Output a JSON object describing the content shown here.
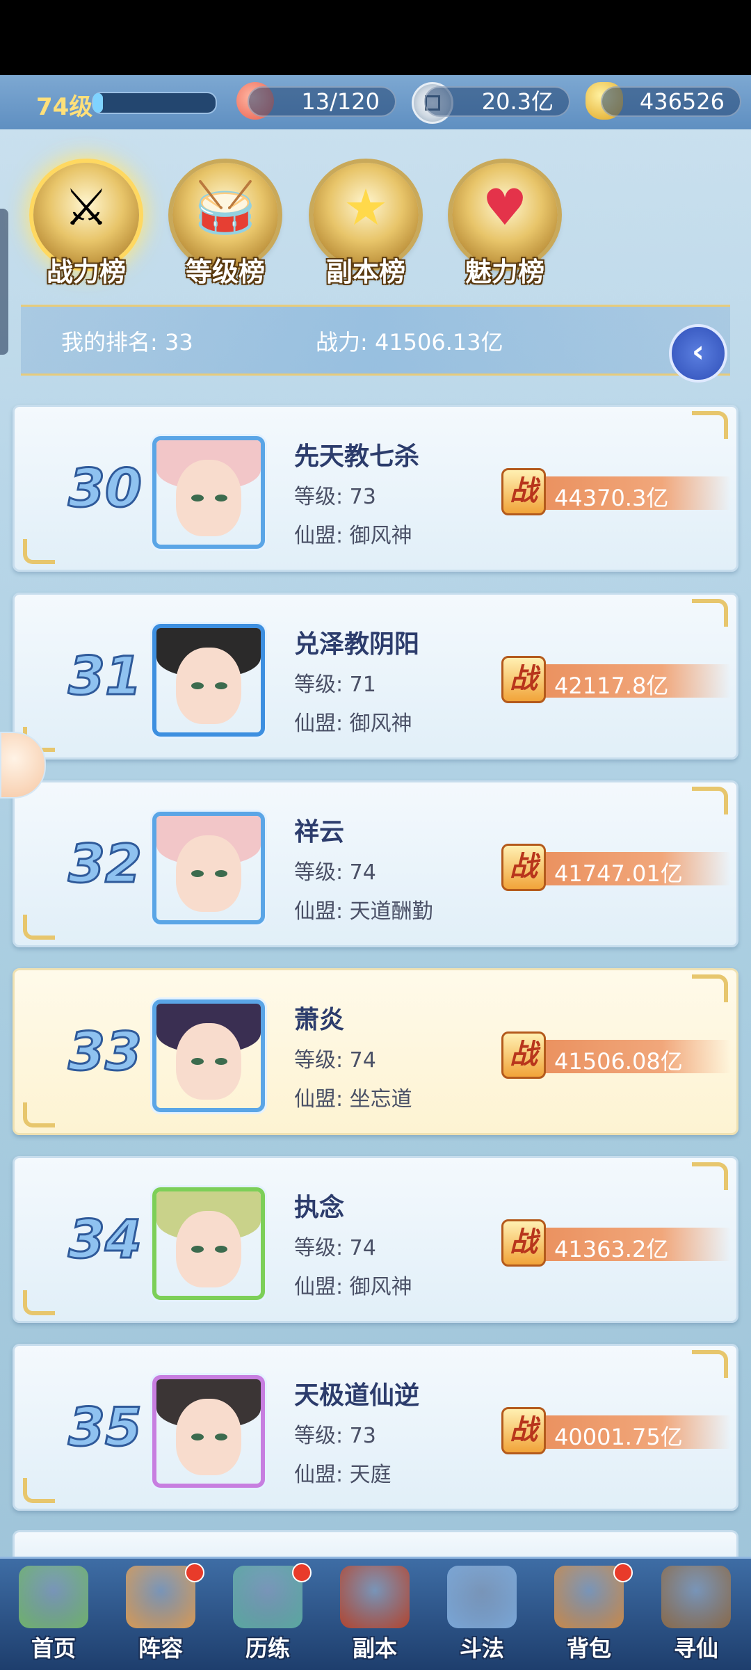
{
  "resources": {
    "level": "74级",
    "xp_progress": 0.08,
    "stamina": "13/120",
    "silver": "20.3亿",
    "gold": "436526"
  },
  "tabs": [
    {
      "label": "战力榜",
      "icon": "sword-emblem-icon",
      "active": true
    },
    {
      "label": "等级榜",
      "icon": "drum-emblem-icon",
      "active": false
    },
    {
      "label": "副本榜",
      "icon": "star-emblem-icon",
      "active": false
    },
    {
      "label": "魅力榜",
      "icon": "heart-emblem-icon",
      "active": false
    }
  ],
  "my_rank": {
    "rank_text": "我的排名: 33",
    "power_text": "战力: 41506.13亿"
  },
  "rank_badge": "战",
  "rows": [
    {
      "rank": "30",
      "name": "先天教七杀",
      "level": "等级: 73",
      "guild": "仙盟: 御风神",
      "power": "44370.3亿",
      "hair": "#f2c6c8",
      "frame": "#5aa5e6",
      "highlight": false
    },
    {
      "rank": "31",
      "name": "兑泽教阴阳",
      "level": "等级: 71",
      "guild": "仙盟: 御风神",
      "power": "42117.8亿",
      "hair": "#2b2a2a",
      "frame": "#3d8fe0",
      "highlight": false
    },
    {
      "rank": "32",
      "name": "祥云",
      "level": "等级: 74",
      "guild": "仙盟: 天道酬勤",
      "power": "41747.01亿",
      "hair": "#f2c6c8",
      "frame": "#5aa5e6",
      "highlight": false
    },
    {
      "rank": "33",
      "name": "萧炎",
      "level": "等级: 74",
      "guild": "仙盟: 坐忘道",
      "power": "41506.08亿",
      "hair": "#3a2f52",
      "frame": "#5aa5e6",
      "highlight": true
    },
    {
      "rank": "34",
      "name": "执念",
      "level": "等级: 74",
      "guild": "仙盟: 御风神",
      "power": "41363.2亿",
      "hair": "#c9d28a",
      "frame": "#7ccf58",
      "highlight": false
    },
    {
      "rank": "35",
      "name": "天极道仙逆",
      "level": "等级: 73",
      "guild": "仙盟: 天庭",
      "power": "40001.75亿",
      "hair": "#3b3535",
      "frame": "#c77ee0",
      "highlight": false
    }
  ],
  "nav": [
    {
      "label": "首页",
      "icon": "home-island-icon",
      "color": "#6fb26c",
      "dot": false
    },
    {
      "label": "阵容",
      "icon": "cards-icon",
      "color": "#d89a55",
      "dot": true
    },
    {
      "label": "历练",
      "icon": "gourd-icon",
      "color": "#5aa8a0",
      "dot": true
    },
    {
      "label": "副本",
      "icon": "gate-icon",
      "color": "#b3452f",
      "dot": false
    },
    {
      "label": "斗法",
      "icon": "crossed-swords-icon",
      "color": "#7aa7d8",
      "dot": false
    },
    {
      "label": "背包",
      "icon": "bag-icon",
      "color": "#c9894a",
      "dot": true
    },
    {
      "label": "寻仙",
      "icon": "scroll-icon",
      "color": "#8a6a4a",
      "dot": false
    }
  ]
}
